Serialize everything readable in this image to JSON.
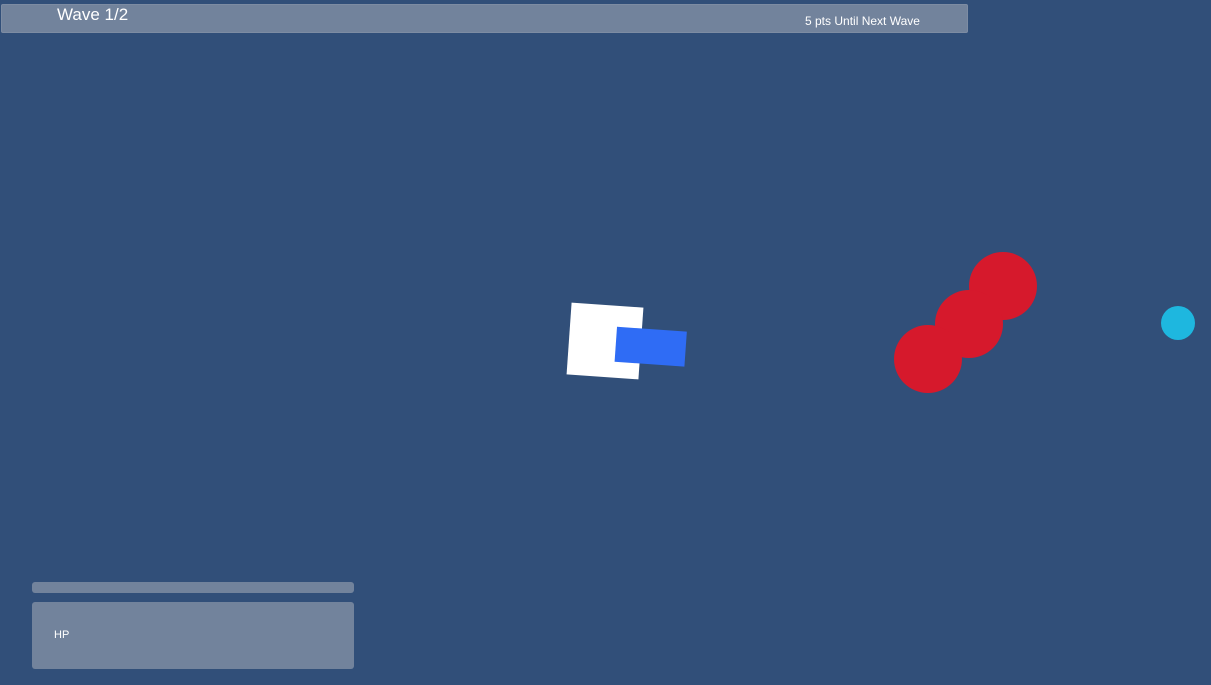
{
  "colors": {
    "background": "#314f79",
    "ui_panel": "#72839c",
    "player_body": "#ffffff",
    "player_cannon": "#2f6cf5",
    "enemy": "#d6192c",
    "pickup": "#1eb7df"
  },
  "hud": {
    "wave_label": "Wave 1/2",
    "next_wave_label": "5 pts Until Next Wave",
    "hp_label": "HP",
    "hp_fraction": 1.0
  },
  "scene": {
    "enemy_count": 3,
    "player": "player-tank",
    "pickup": "pickup-orb"
  }
}
